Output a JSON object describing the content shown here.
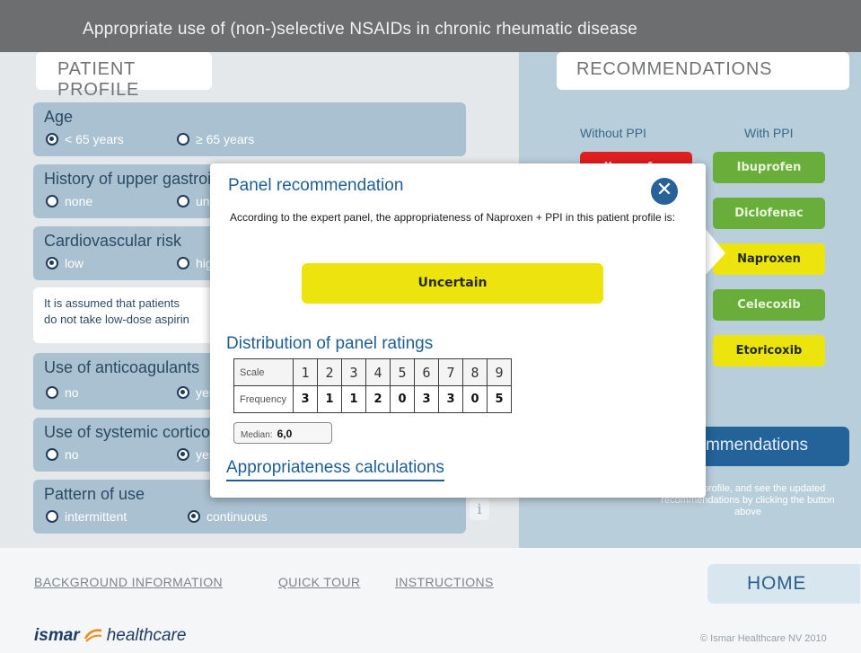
{
  "app": {
    "title": "Appropriate use of (non-)selective NSAIDs in chronic rheumatic disease"
  },
  "patient_profile": {
    "header": "PATIENT PROFILE",
    "questions": [
      {
        "label": "Age",
        "options": [
          "< 65 years",
          "≥ 65 years"
        ],
        "selected": 0
      },
      {
        "label": "History of upper gastrointestinal events",
        "options": [
          "none",
          "uncomplicated"
        ],
        "selected": null
      },
      {
        "label": "Cardiovascular risk",
        "options": [
          "low",
          "high"
        ],
        "selected": 0
      },
      {
        "label": "Use of anticoagulants",
        "options": [
          "no",
          "yes"
        ],
        "selected": 1
      },
      {
        "label": "Use of systemic corticosteroids",
        "options": [
          "no",
          "yes"
        ],
        "selected": 1
      },
      {
        "label": "Pattern of use",
        "options": [
          "intermittent",
          "continuous"
        ],
        "selected": 1
      }
    ],
    "note_line1": "It is assumed that patients",
    "note_line2": "do not take low-dose aspirin"
  },
  "recommendations": {
    "header": "RECOMMENDATIONS",
    "without_ppi_label": "Without PPI",
    "with_ppi_label": "With PPI",
    "without_ppi": [
      {
        "name": "Ibuprofen",
        "rating": "red"
      }
    ],
    "with_ppi": [
      {
        "name": "Ibuprofen",
        "rating": "green"
      },
      {
        "name": "Diclofenac",
        "rating": "green"
      },
      {
        "name": "Naproxen",
        "rating": "yellow"
      },
      {
        "name": "Celecoxib",
        "rating": "green"
      },
      {
        "name": "Etoricoxib",
        "rating": "yellow"
      }
    ],
    "update_button": "mmendations",
    "update_note": "patient profile, and see the updated recommendations by clicking the button above"
  },
  "modal": {
    "title": "Panel recommendation",
    "close_symbol": "✕",
    "text": "According to the expert panel, the appropriateness of Naproxen + PPI in this patient profile is:",
    "verdict": "Uncertain",
    "distribution_title": "Distribution of panel ratings",
    "scale_label": "Scale",
    "frequency_label": "Frequency",
    "scale": [
      "1",
      "2",
      "3",
      "4",
      "5",
      "6",
      "7",
      "8",
      "9"
    ],
    "frequency": [
      "3",
      "1",
      "1",
      "2",
      "0",
      "3",
      "3",
      "0",
      "5"
    ],
    "median_label": "Median:",
    "median_value": "6,0",
    "calculations_link": "Appropriateness calculations"
  },
  "nav": {
    "background": "BACKGROUND INFORMATION",
    "quick_tour": "QUICK TOUR",
    "instructions": "INSTRUCTIONS",
    "home": "HOME"
  },
  "footer": {
    "logo_bold": "ismar",
    "logo_rest": "healthcare",
    "copyright": "© Ismar Healthcare NV 2010"
  },
  "colors": {
    "title_bar": "#6c6e70",
    "accent_blue": "#23639a",
    "green": "#69ad3b",
    "yellow": "#eee40d",
    "red": "#e01f20"
  },
  "icons": {
    "close": "close-icon",
    "info": "info-icon",
    "logo_swirl": "swirl-icon"
  }
}
